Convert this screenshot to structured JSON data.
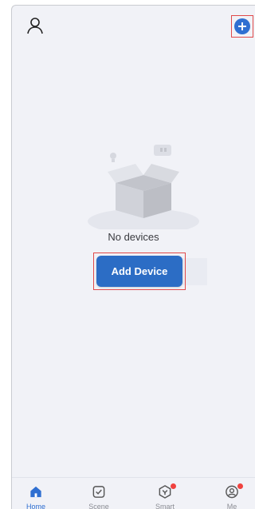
{
  "empty_state": {
    "message": "No devices",
    "button_label": "Add Device"
  },
  "tabs": [
    {
      "label": "Home",
      "icon": "home-icon",
      "active": true
    },
    {
      "label": "Scene",
      "icon": "scene-icon",
      "active": false
    },
    {
      "label": "Smart",
      "icon": "smart-icon",
      "active": false,
      "badge": true
    },
    {
      "label": "Me",
      "icon": "me-icon",
      "active": false,
      "badge": true
    }
  ],
  "colors": {
    "accent": "#2f6fd1",
    "button": "#2c6dc5",
    "badge": "#f0423f",
    "background": "#f1f2f7"
  }
}
